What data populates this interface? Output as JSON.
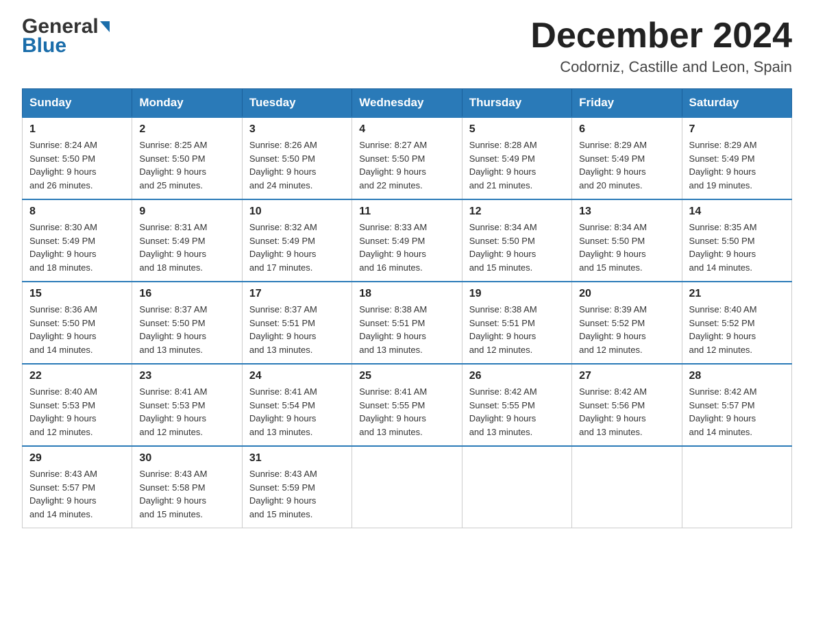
{
  "header": {
    "title": "December 2024",
    "subtitle": "Codorniz, Castille and Leon, Spain",
    "logo_general": "General",
    "logo_blue": "Blue"
  },
  "calendar": {
    "days_of_week": [
      "Sunday",
      "Monday",
      "Tuesday",
      "Wednesday",
      "Thursday",
      "Friday",
      "Saturday"
    ],
    "weeks": [
      [
        {
          "day": "1",
          "sunrise": "8:24 AM",
          "sunset": "5:50 PM",
          "daylight": "9 hours and 26 minutes."
        },
        {
          "day": "2",
          "sunrise": "8:25 AM",
          "sunset": "5:50 PM",
          "daylight": "9 hours and 25 minutes."
        },
        {
          "day": "3",
          "sunrise": "8:26 AM",
          "sunset": "5:50 PM",
          "daylight": "9 hours and 24 minutes."
        },
        {
          "day": "4",
          "sunrise": "8:27 AM",
          "sunset": "5:50 PM",
          "daylight": "9 hours and 22 minutes."
        },
        {
          "day": "5",
          "sunrise": "8:28 AM",
          "sunset": "5:49 PM",
          "daylight": "9 hours and 21 minutes."
        },
        {
          "day": "6",
          "sunrise": "8:29 AM",
          "sunset": "5:49 PM",
          "daylight": "9 hours and 20 minutes."
        },
        {
          "day": "7",
          "sunrise": "8:29 AM",
          "sunset": "5:49 PM",
          "daylight": "9 hours and 19 minutes."
        }
      ],
      [
        {
          "day": "8",
          "sunrise": "8:30 AM",
          "sunset": "5:49 PM",
          "daylight": "9 hours and 18 minutes."
        },
        {
          "day": "9",
          "sunrise": "8:31 AM",
          "sunset": "5:49 PM",
          "daylight": "9 hours and 18 minutes."
        },
        {
          "day": "10",
          "sunrise": "8:32 AM",
          "sunset": "5:49 PM",
          "daylight": "9 hours and 17 minutes."
        },
        {
          "day": "11",
          "sunrise": "8:33 AM",
          "sunset": "5:49 PM",
          "daylight": "9 hours and 16 minutes."
        },
        {
          "day": "12",
          "sunrise": "8:34 AM",
          "sunset": "5:50 PM",
          "daylight": "9 hours and 15 minutes."
        },
        {
          "day": "13",
          "sunrise": "8:34 AM",
          "sunset": "5:50 PM",
          "daylight": "9 hours and 15 minutes."
        },
        {
          "day": "14",
          "sunrise": "8:35 AM",
          "sunset": "5:50 PM",
          "daylight": "9 hours and 14 minutes."
        }
      ],
      [
        {
          "day": "15",
          "sunrise": "8:36 AM",
          "sunset": "5:50 PM",
          "daylight": "9 hours and 14 minutes."
        },
        {
          "day": "16",
          "sunrise": "8:37 AM",
          "sunset": "5:50 PM",
          "daylight": "9 hours and 13 minutes."
        },
        {
          "day": "17",
          "sunrise": "8:37 AM",
          "sunset": "5:51 PM",
          "daylight": "9 hours and 13 minutes."
        },
        {
          "day": "18",
          "sunrise": "8:38 AM",
          "sunset": "5:51 PM",
          "daylight": "9 hours and 13 minutes."
        },
        {
          "day": "19",
          "sunrise": "8:38 AM",
          "sunset": "5:51 PM",
          "daylight": "9 hours and 12 minutes."
        },
        {
          "day": "20",
          "sunrise": "8:39 AM",
          "sunset": "5:52 PM",
          "daylight": "9 hours and 12 minutes."
        },
        {
          "day": "21",
          "sunrise": "8:40 AM",
          "sunset": "5:52 PM",
          "daylight": "9 hours and 12 minutes."
        }
      ],
      [
        {
          "day": "22",
          "sunrise": "8:40 AM",
          "sunset": "5:53 PM",
          "daylight": "9 hours and 12 minutes."
        },
        {
          "day": "23",
          "sunrise": "8:41 AM",
          "sunset": "5:53 PM",
          "daylight": "9 hours and 12 minutes."
        },
        {
          "day": "24",
          "sunrise": "8:41 AM",
          "sunset": "5:54 PM",
          "daylight": "9 hours and 13 minutes."
        },
        {
          "day": "25",
          "sunrise": "8:41 AM",
          "sunset": "5:55 PM",
          "daylight": "9 hours and 13 minutes."
        },
        {
          "day": "26",
          "sunrise": "8:42 AM",
          "sunset": "5:55 PM",
          "daylight": "9 hours and 13 minutes."
        },
        {
          "day": "27",
          "sunrise": "8:42 AM",
          "sunset": "5:56 PM",
          "daylight": "9 hours and 13 minutes."
        },
        {
          "day": "28",
          "sunrise": "8:42 AM",
          "sunset": "5:57 PM",
          "daylight": "9 hours and 14 minutes."
        }
      ],
      [
        {
          "day": "29",
          "sunrise": "8:43 AM",
          "sunset": "5:57 PM",
          "daylight": "9 hours and 14 minutes."
        },
        {
          "day": "30",
          "sunrise": "8:43 AM",
          "sunset": "5:58 PM",
          "daylight": "9 hours and 15 minutes."
        },
        {
          "day": "31",
          "sunrise": "8:43 AM",
          "sunset": "5:59 PM",
          "daylight": "9 hours and 15 minutes."
        },
        null,
        null,
        null,
        null
      ]
    ],
    "labels": {
      "sunrise": "Sunrise:",
      "sunset": "Sunset:",
      "daylight": "Daylight:"
    }
  }
}
